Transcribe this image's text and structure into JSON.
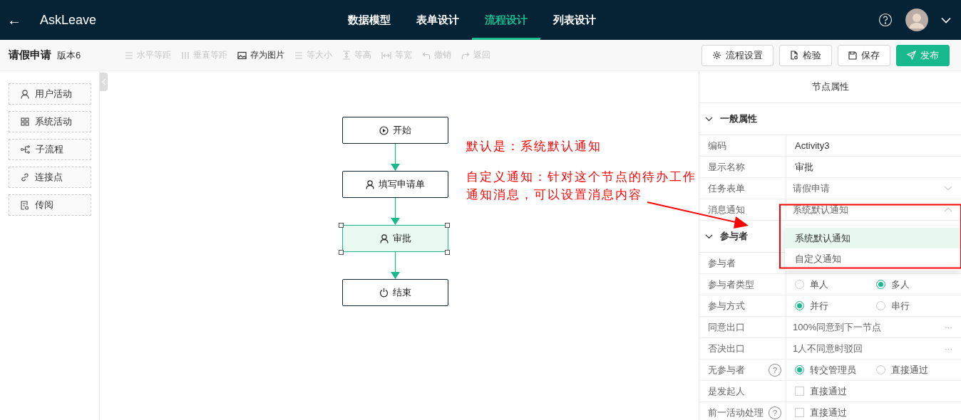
{
  "header": {
    "back": "←",
    "title": "AskLeave",
    "nav": [
      {
        "label": "数据模型",
        "selected": false
      },
      {
        "label": "表单设计",
        "selected": false
      },
      {
        "label": "流程设计",
        "selected": true
      },
      {
        "label": "列表设计",
        "selected": false
      }
    ]
  },
  "toolbar": {
    "title": "请假申请",
    "version": "版本6",
    "tools": [
      {
        "label": "水平等距",
        "kind": "hspace",
        "disabled": true
      },
      {
        "label": "垂直等距",
        "kind": "vspace",
        "disabled": true
      },
      {
        "label": "存为图片",
        "kind": "image",
        "disabled": false
      },
      {
        "label": "等大小",
        "kind": "size",
        "disabled": true
      },
      {
        "label": "等高",
        "kind": "height",
        "disabled": true
      },
      {
        "label": "等宽",
        "kind": "width",
        "disabled": true
      },
      {
        "label": "撤销",
        "kind": "undo",
        "disabled": true
      },
      {
        "label": "返回",
        "kind": "redo",
        "disabled": true
      }
    ],
    "buttons": [
      {
        "label": "流程设置",
        "kind": "settings"
      },
      {
        "label": "检验",
        "kind": "check"
      },
      {
        "label": "保存",
        "kind": "save"
      },
      {
        "label": "发布",
        "kind": "publish"
      }
    ]
  },
  "palette": [
    {
      "label": "用户活动",
      "kind": "user"
    },
    {
      "label": "系统活动",
      "kind": "system"
    },
    {
      "label": "子流程",
      "kind": "subflow"
    },
    {
      "label": "连接点",
      "kind": "link"
    },
    {
      "label": "传阅",
      "kind": "circulate"
    }
  ],
  "flow": {
    "nodes": [
      {
        "label": "开始",
        "kind": "start",
        "selected": false
      },
      {
        "label": "填写申请单",
        "kind": "user",
        "selected": false
      },
      {
        "label": "审批",
        "kind": "user",
        "selected": true
      },
      {
        "label": "结束",
        "kind": "end",
        "selected": false
      }
    ]
  },
  "annotations": [
    "默认是：系统默认通知",
    "自定义通知：针对这个节点的待办工作通知消息，可以设置消息内容"
  ],
  "panel": {
    "title": "节点属性",
    "sections": [
      {
        "title": "一般属性",
        "expanded": true,
        "rows": [
          {
            "kind": "text",
            "label": "编码",
            "value": "Activity3"
          },
          {
            "kind": "text",
            "label": "显示名称",
            "value": "审批"
          },
          {
            "kind": "select",
            "label": "任务表单",
            "value": "请假申请",
            "open": false
          },
          {
            "kind": "select",
            "label": "消息通知",
            "value": "系统默认通知",
            "open": true,
            "options": [
              {
                "label": "系统默认通知",
                "selected": true
              },
              {
                "label": "自定义通知",
                "selected": false
              }
            ]
          }
        ]
      },
      {
        "title": "参与者",
        "expanded": true,
        "rows": [
          {
            "kind": "text",
            "label": "参与者"
          },
          {
            "kind": "radio",
            "label": "参与者类型",
            "options": [
              {
                "label": "单人",
                "selected": false
              },
              {
                "label": "多人",
                "selected": true
              }
            ]
          },
          {
            "kind": "radio",
            "label": "参与方式",
            "options": [
              {
                "label": "并行",
                "selected": true
              },
              {
                "label": "串行",
                "selected": false
              }
            ]
          },
          {
            "kind": "more",
            "label": "同意出口",
            "value": "100%同意到下一节点",
            "more": "···"
          },
          {
            "kind": "more",
            "label": "否决出口",
            "value": "1人不同意时驳回",
            "more": "···"
          },
          {
            "kind": "radio",
            "label": "无参与者",
            "help": "?",
            "options": [
              {
                "label": "转交管理员",
                "selected": true
              },
              {
                "label": "直接通过",
                "selected": false
              }
            ]
          },
          {
            "kind": "checkbox",
            "label": "是发起人",
            "options": [
              {
                "label": "直接通过",
                "checked": false
              }
            ]
          },
          {
            "kind": "checkbox",
            "label": "前一活动处理",
            "help": "?",
            "options": [
              {
                "label": "直接通过",
                "checked": false
              }
            ]
          }
        ]
      }
    ]
  }
}
